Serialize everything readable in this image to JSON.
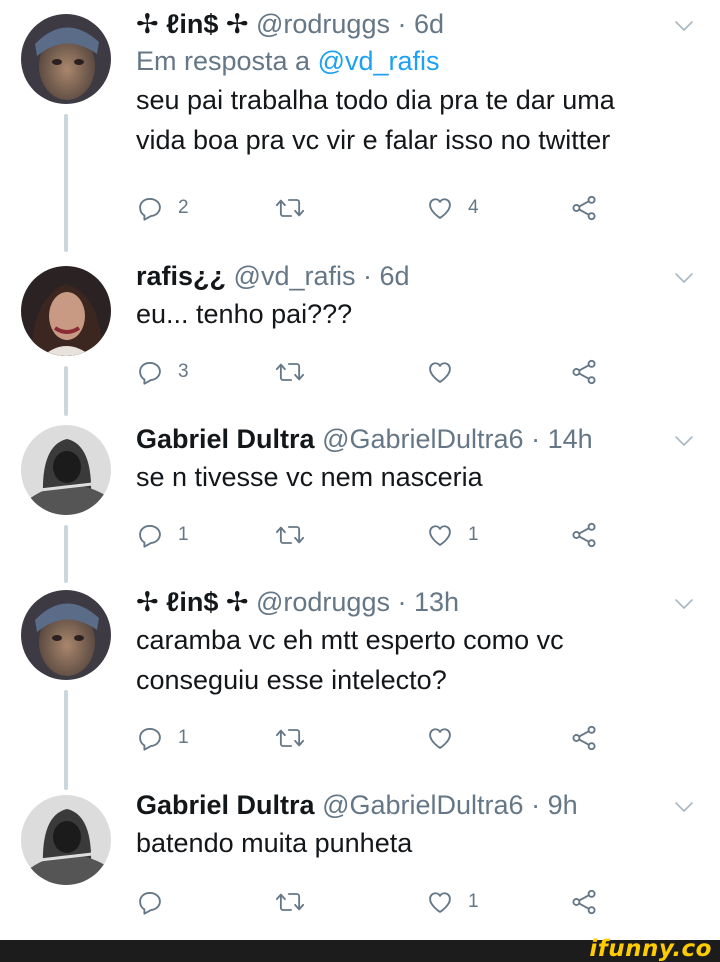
{
  "tweets": [
    {
      "name": "✢ ℓin$ ✢",
      "handle": "@rodruggs",
      "time": "· 6d",
      "reply_prefix": "Em resposta a ",
      "reply_mention": "@vd_rafis",
      "text": "seu pai trabalha todo dia pra te dar uma vida boa pra vc vir e falar isso no twitter",
      "replies": "2",
      "retweets": "",
      "likes": "4"
    },
    {
      "name": "rafis¿¿",
      "handle": "@vd_rafis",
      "time": "· 6d",
      "text": "eu... tenho pai???",
      "replies": "3",
      "retweets": "",
      "likes": ""
    },
    {
      "name": "Gabriel Dultra",
      "handle": "@GabrielDultra6",
      "time": "· 14h",
      "text": "se n tivesse vc nem nasceria",
      "replies": "1",
      "retweets": "",
      "likes": "1"
    },
    {
      "name": "✢ ℓin$ ✢",
      "handle": "@rodruggs",
      "time": "· 13h",
      "text": "caramba vc eh mtt esperto como vc conseguiu esse intelecto?",
      "replies": "1",
      "retweets": "",
      "likes": ""
    },
    {
      "name": "Gabriel Dultra",
      "handle": "@GabrielDultra6",
      "time": "· 9h",
      "text": "batendo muita punheta",
      "replies": "",
      "retweets": "",
      "likes": "1"
    }
  ],
  "icons": {
    "reply": "reply-icon",
    "retweet": "retweet-icon",
    "like": "heart-icon",
    "share": "share-icon",
    "menu": "chevron-down-icon"
  },
  "colors": {
    "text": "#14171a",
    "secondary": "#657786",
    "link": "#1da1f2",
    "thread_line": "#ccd6dd"
  },
  "footer": {
    "brand": "ifunny.co"
  }
}
